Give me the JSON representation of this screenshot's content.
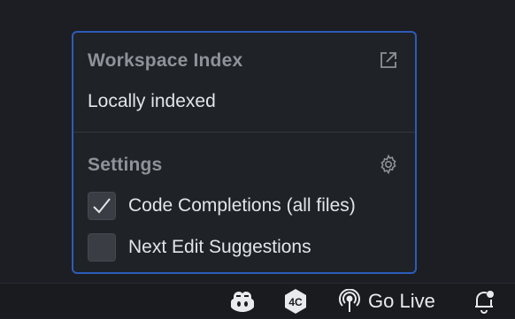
{
  "popup": {
    "workspace_index": {
      "title": "Workspace Index",
      "status": "Locally indexed",
      "open_icon": "external-link-icon"
    },
    "settings": {
      "title": "Settings",
      "gear_icon": "gear-icon",
      "options": [
        {
          "label": "Code Completions (all files)",
          "checked": true
        },
        {
          "label": "Next Edit Suggestions",
          "checked": false
        }
      ]
    }
  },
  "statusbar": {
    "copilot_icon": "copilot-icon",
    "extension_badge": "4C",
    "go_live_label": "Go Live",
    "notifications_icon": "bell-icon"
  },
  "colors": {
    "accent_border": "#2d5cb8",
    "popup_bg": "#1f2227",
    "checkbox_bg": "#3a3d43"
  }
}
